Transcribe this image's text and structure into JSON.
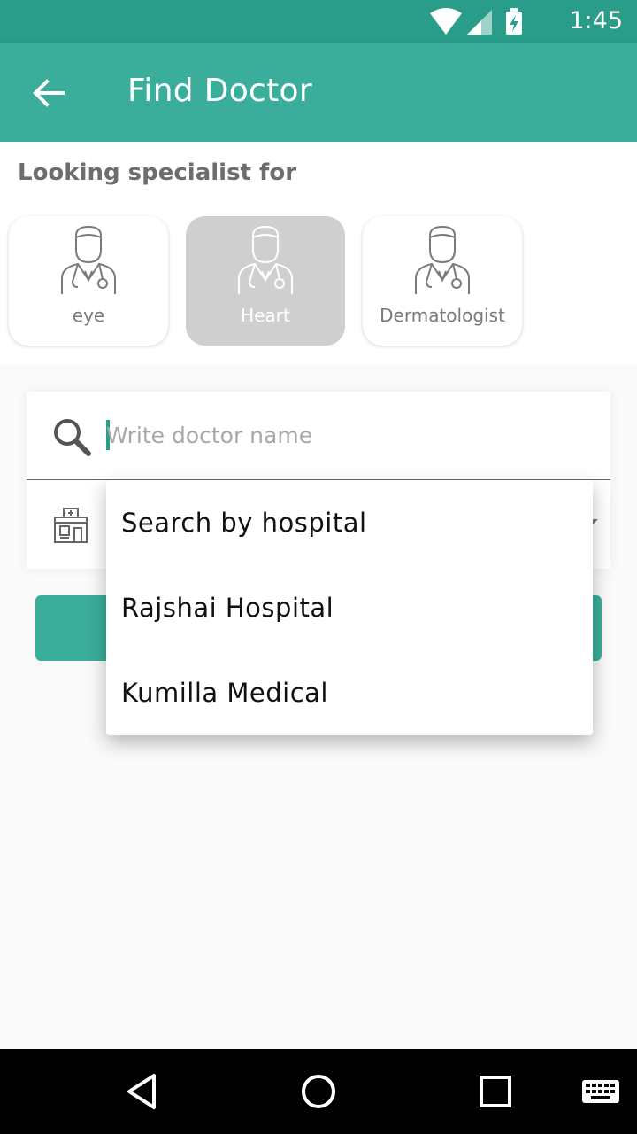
{
  "status_bar": {
    "time": "1:45",
    "icons": [
      "wifi-icon",
      "signal-icon",
      "battery-charging-icon"
    ],
    "background": "#2a9d8a"
  },
  "app_bar": {
    "title": "Find Doctor",
    "back_icon": "arrow-back-icon",
    "background": "#3aae9a"
  },
  "specialists": {
    "heading": "Looking specialist for",
    "items": [
      {
        "label": "eye",
        "icon": "doctor-icon",
        "selected": false
      },
      {
        "label": "Heart",
        "icon": "doctor-icon",
        "selected": true
      },
      {
        "label": "Dermatologist",
        "icon": "doctor-icon",
        "selected": false
      }
    ]
  },
  "search": {
    "placeholder": "Write doctor name",
    "value": "",
    "icon": "search-icon"
  },
  "hospital_select": {
    "icon": "hospital-icon",
    "options": [
      "Search by hospital",
      "Rajshai Hospital",
      "Kumilla Medical"
    ]
  },
  "accent_color": "#3aae9a",
  "nav_bar": {
    "buttons": [
      "back-triangle-icon",
      "home-circle-icon",
      "recents-square-icon",
      "keyboard-icon"
    ]
  }
}
